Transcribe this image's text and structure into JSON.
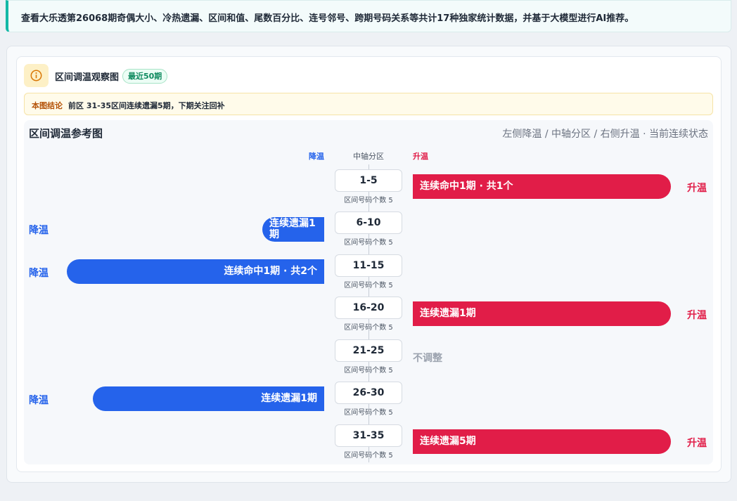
{
  "notice": "查看大乐透第26068期奇偶大小、冷热遗漏、区间和值、尾数百分比、连号邻号、跨期号码关系等共计17种独家统计数据，并基于大模型进行AI推荐。",
  "card": {
    "icon": "info-icon",
    "title": "区间调温观察图",
    "badge": "最近50期",
    "conclusion_label": "本图结论",
    "conclusion_text": "前区 31-35区间连续遗漏5期，下期关注回补"
  },
  "chart": {
    "title": "区间调温参考图",
    "legend": "左侧降温 / 中轴分区 / 右侧升温 · 当前连续状态",
    "col_cool": "降温",
    "col_axis": "中轴分区",
    "col_warm": "升温",
    "colors": {
      "warm": "#e11d48",
      "cool": "#2563eb",
      "neutral": "#9ca3af"
    }
  },
  "chart_data": {
    "type": "table",
    "rows": [
      {
        "zone": "1-5",
        "count_label": "区间号码个数 5",
        "direction": "升温",
        "bar_text": "连续命中1期 · 共1个",
        "side_label": "升温"
      },
      {
        "zone": "6-10",
        "count_label": "区间号码个数 5",
        "direction": "降温",
        "bar_text": "连续遗漏1期",
        "side_label": "降温"
      },
      {
        "zone": "11-15",
        "count_label": "区间号码个数 5",
        "direction": "降温",
        "bar_text": "连续命中1期 · 共2个",
        "side_label": "降温"
      },
      {
        "zone": "16-20",
        "count_label": "区间号码个数 5",
        "direction": "升温",
        "bar_text": "连续遗漏1期",
        "side_label": "升温"
      },
      {
        "zone": "21-25",
        "count_label": "区间号码个数 5",
        "direction": "不调整",
        "bar_text": "",
        "side_label": "不调整"
      },
      {
        "zone": "26-30",
        "count_label": "区间号码个数 5",
        "direction": "降温",
        "bar_text": "连续遗漏1期",
        "side_label": "降温"
      },
      {
        "zone": "31-35",
        "count_label": "区间号码个数 5",
        "direction": "升温",
        "bar_text": "连续遗漏5期",
        "side_label": "升温"
      }
    ]
  }
}
